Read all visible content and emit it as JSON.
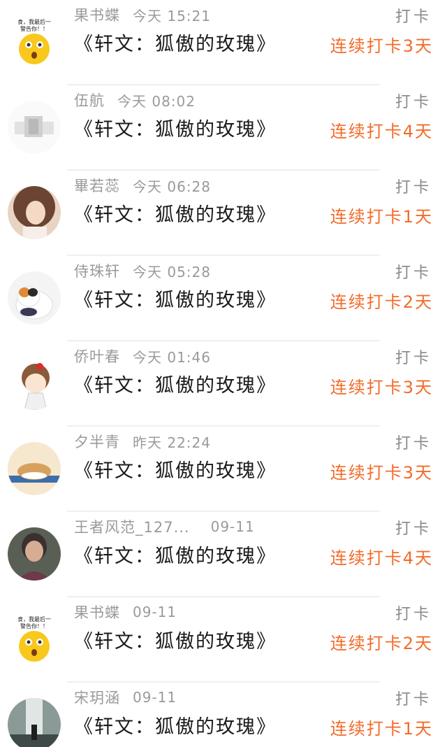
{
  "items": [
    {
      "name": "果书蝶",
      "time": "今天 15:21",
      "title": "《轩文：狐傲的玫瑰》",
      "checkin": "打卡",
      "streak": "连续打卡3天",
      "avatar": "avatar-emoji",
      "avatar_caption": "食，我最后一\n警告你！！"
    },
    {
      "name": "伍航",
      "time": "今天 08:02",
      "title": "《轩文：狐傲的玫瑰》",
      "checkin": "打卡",
      "streak": "连续打卡4天",
      "avatar": "avatar-sketch",
      "avatar_caption": ""
    },
    {
      "name": "畢若蕊",
      "time": "今天 06:28",
      "title": "《轩文：狐傲的玫瑰》",
      "checkin": "打卡",
      "streak": "连续打卡1天",
      "avatar": "avatar-girl-photo",
      "avatar_caption": ""
    },
    {
      "name": "侍珠轩",
      "time": "今天 05:28",
      "title": "《轩文：狐傲的玫瑰》",
      "checkin": "打卡",
      "streak": "连续打卡2天",
      "avatar": "avatar-cat",
      "avatar_caption": ""
    },
    {
      "name": "侨叶春",
      "time": "今天 01:46",
      "title": "《轩文：狐傲的玫瑰》",
      "checkin": "打卡",
      "streak": "连续打卡3天",
      "avatar": "avatar-cartoon-girl",
      "avatar_caption": ""
    },
    {
      "name": "夕半青",
      "time": "昨天 22:24",
      "title": "《轩文：狐傲的玫瑰》",
      "checkin": "打卡",
      "streak": "连续打卡3天",
      "avatar": "avatar-hamster",
      "avatar_caption": ""
    },
    {
      "name": "王者风范_127...",
      "time": "09-11",
      "title": "《轩文：狐傲的玫瑰》",
      "checkin": "打卡",
      "streak": "连续打卡4天",
      "avatar": "avatar-elder-photo",
      "avatar_caption": ""
    },
    {
      "name": "果书蝶",
      "time": "09-11",
      "title": "《轩文：狐傲的玫瑰》",
      "checkin": "打卡",
      "streak": "连续打卡2天",
      "avatar": "avatar-emoji",
      "avatar_caption": "食，我最后一\n警告你！！"
    },
    {
      "name": "宋玥涵",
      "time": "09-11",
      "title": "《轩文：狐傲的玫瑰》",
      "checkin": "打卡",
      "streak": "连续打卡1天",
      "avatar": "avatar-waterfall-photo",
      "avatar_caption": ""
    }
  ],
  "colors": {
    "streak": "#f36b2a",
    "meta": "#9a9a9a",
    "title": "#1a1a1a",
    "checkin": "#8a8a8a",
    "divider": "#f0f0f0"
  }
}
